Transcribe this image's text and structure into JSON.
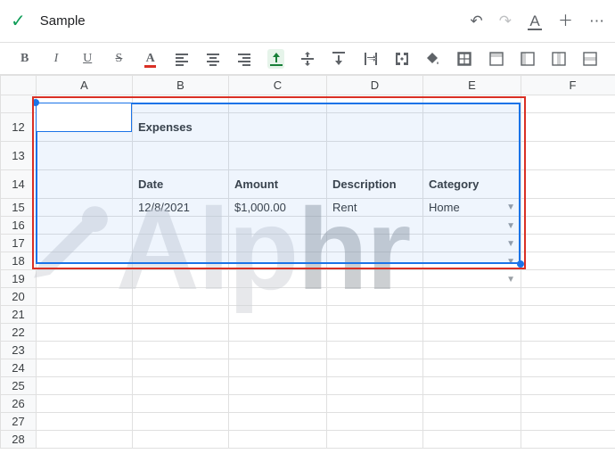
{
  "topbar": {
    "title": "Sample"
  },
  "columns": [
    "A",
    "B",
    "C",
    "D",
    "E",
    "F"
  ],
  "rows": [
    "",
    "12",
    "13",
    "14",
    "15",
    "16",
    "17",
    "18",
    "19",
    "20",
    "21",
    "22",
    "23",
    "24",
    "25",
    "26",
    "27",
    "28"
  ],
  "content": {
    "title": "Expenses",
    "headers": {
      "date": "Date",
      "amount": "Amount",
      "desc": "Description",
      "cat": "Category"
    },
    "row15": {
      "date": "12/8/2021",
      "amount": "$1,000.00",
      "desc": "Rent",
      "cat": "Home"
    }
  },
  "watermark": {
    "part1": "Alp",
    "part2": "hr"
  },
  "chart_data": {
    "type": "table",
    "title": "Expenses",
    "columns": [
      "Date",
      "Amount",
      "Description",
      "Category"
    ],
    "rows": [
      {
        "Date": "12/8/2021",
        "Amount": "$1,000.00",
        "Description": "Rent",
        "Category": "Home"
      },
      {
        "Date": "",
        "Amount": "",
        "Description": "",
        "Category": ""
      },
      {
        "Date": "",
        "Amount": "",
        "Description": "",
        "Category": ""
      },
      {
        "Date": "",
        "Amount": "",
        "Description": "",
        "Category": ""
      },
      {
        "Date": "",
        "Amount": "",
        "Description": "",
        "Category": ""
      }
    ]
  }
}
